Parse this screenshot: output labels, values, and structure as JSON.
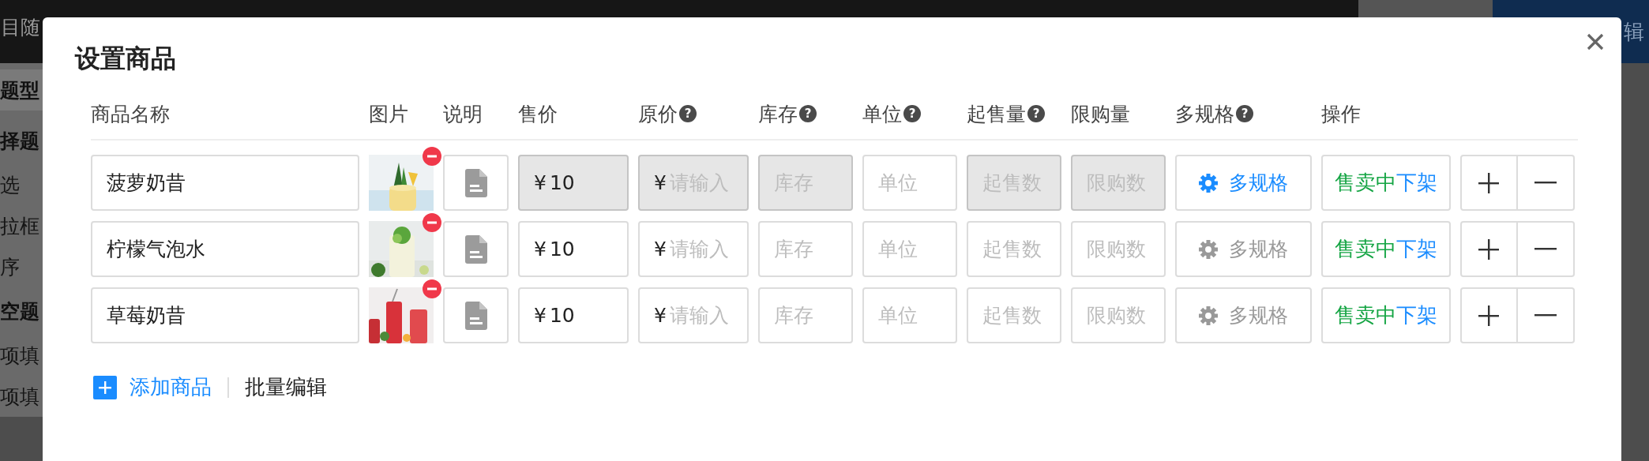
{
  "backdrop": {
    "top_text": "目随",
    "top_right_text": "辑",
    "sidebar_items": [
      {
        "label": "题型",
        "kind": "tab"
      },
      {
        "label": "择题",
        "kind": "heading"
      },
      {
        "label": "选",
        "kind": "item"
      },
      {
        "label": "拉框",
        "kind": "item"
      },
      {
        "label": "序",
        "kind": "item"
      },
      {
        "label": "空题",
        "kind": "heading"
      },
      {
        "label": "项填",
        "kind": "item"
      },
      {
        "label": "项填",
        "kind": "item"
      }
    ]
  },
  "dialog": {
    "title": "设置商品",
    "columns": [
      {
        "label": "商品名称"
      },
      {
        "label": "图片"
      },
      {
        "label": "说明"
      },
      {
        "label": "售价"
      },
      {
        "label": "原价",
        "help": "?"
      },
      {
        "label": "库存",
        "help": "?"
      },
      {
        "label": "单位",
        "help": "?"
      },
      {
        "label": "起售量",
        "help": "?"
      },
      {
        "label": "限购量"
      },
      {
        "label": "多规格",
        "help": "?"
      },
      {
        "label": "操作"
      }
    ],
    "rows": [
      {
        "name": "菠萝奶昔",
        "price": {
          "prefix": "¥",
          "value": "10",
          "disabled": true
        },
        "original_price": {
          "prefix": "¥",
          "placeholder": "请输入",
          "disabled": true
        },
        "stock": {
          "placeholder": "库存",
          "disabled": true
        },
        "unit": {
          "placeholder": "单位",
          "disabled": false
        },
        "min_qty": {
          "placeholder": "起售数",
          "disabled": true
        },
        "limit_qty": {
          "placeholder": "限购数",
          "disabled": true
        },
        "multi_spec": {
          "label": "多规格",
          "on": true
        },
        "status": "售卖中",
        "action": "下架"
      },
      {
        "name": "柠檬气泡水",
        "price": {
          "prefix": "¥",
          "value": "10",
          "disabled": false
        },
        "original_price": {
          "prefix": "¥",
          "placeholder": "请输入",
          "disabled": false
        },
        "stock": {
          "placeholder": "库存",
          "disabled": false
        },
        "unit": {
          "placeholder": "单位",
          "disabled": false
        },
        "min_qty": {
          "placeholder": "起售数",
          "disabled": false
        },
        "limit_qty": {
          "placeholder": "限购数",
          "disabled": false
        },
        "multi_spec": {
          "label": "多规格",
          "on": false
        },
        "status": "售卖中",
        "action": "下架"
      },
      {
        "name": "草莓奶昔",
        "price": {
          "prefix": "¥",
          "value": "10",
          "disabled": false
        },
        "original_price": {
          "prefix": "¥",
          "placeholder": "请输入",
          "disabled": false
        },
        "stock": {
          "placeholder": "库存",
          "disabled": false
        },
        "unit": {
          "placeholder": "单位",
          "disabled": false
        },
        "min_qty": {
          "placeholder": "起售数",
          "disabled": false
        },
        "limit_qty": {
          "placeholder": "限购数",
          "disabled": false
        },
        "multi_spec": {
          "label": "多规格",
          "on": false
        },
        "status": "售卖中",
        "action": "下架"
      }
    ],
    "footer": {
      "add_label": "添加商品",
      "batch_label": "批量编辑"
    }
  }
}
